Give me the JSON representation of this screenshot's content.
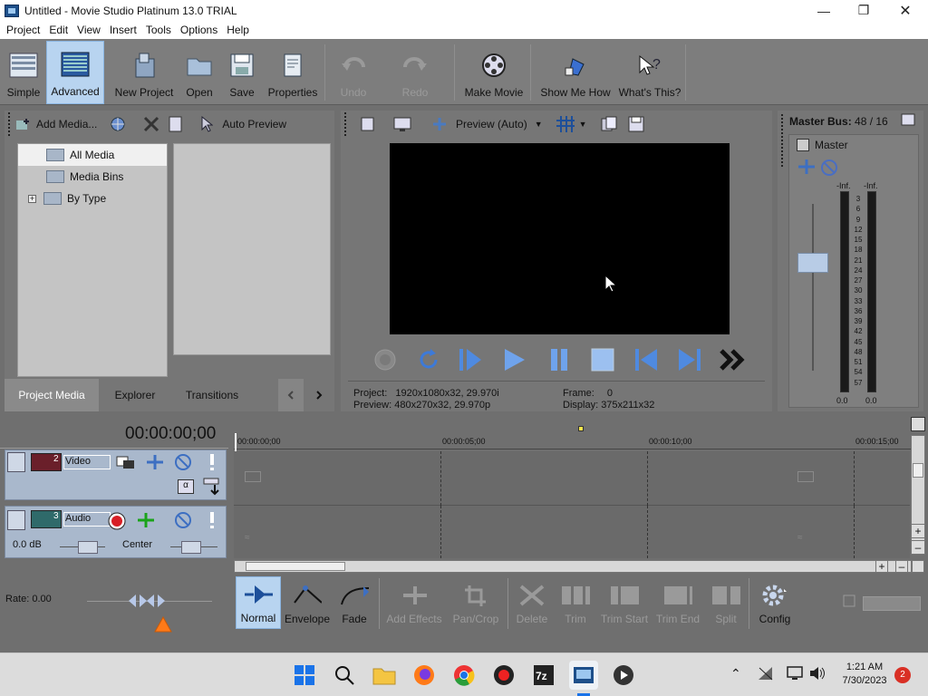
{
  "window": {
    "title": "Untitled - Movie Studio Platinum 13.0 TRIAL"
  },
  "menu": [
    "Project",
    "Edit",
    "View",
    "Insert",
    "Tools",
    "Options",
    "Help"
  ],
  "toolbar": {
    "simple": "Simple",
    "advanced": "Advanced",
    "new_project": "New Project",
    "open": "Open",
    "save": "Save",
    "properties": "Properties",
    "undo": "Undo",
    "redo": "Redo",
    "make_movie": "Make Movie",
    "show_me_how": "Show Me How",
    "whats_this": "What's This?"
  },
  "media_panel": {
    "add_media": "Add Media...",
    "auto_preview": "Auto Preview",
    "tree": [
      "All Media",
      "Media Bins",
      "By Type"
    ],
    "tabs": [
      "Project Media",
      "Explorer",
      "Transitions"
    ]
  },
  "preview": {
    "mode": "Preview (Auto)",
    "project_label": "Project:",
    "project_value": "1920x1080x32, 29.970i",
    "preview_label": "Preview:",
    "preview_value": "480x270x32, 29.970p",
    "frame_label": "Frame:",
    "frame_value": "0",
    "display_label": "Display:",
    "display_value": "375x211x32"
  },
  "master": {
    "title": "Master Bus:",
    "count": "48 / 16",
    "label": "Master",
    "inf": "-Inf.",
    "scale": [
      "3",
      "6",
      "9",
      "12",
      "15",
      "18",
      "21",
      "24",
      "27",
      "30",
      "33",
      "36",
      "39",
      "42",
      "45",
      "48",
      "51",
      "54",
      "57"
    ],
    "bottom": "0.0"
  },
  "timeline": {
    "timecode": "00:00:00;00",
    "ruler": [
      "00:00:00;00",
      "00:00:05;00",
      "00:00:10;00",
      "00:00:15;00"
    ],
    "video_track": {
      "num": "2",
      "name": "Video"
    },
    "audio_track": {
      "num": "3",
      "name": "Audio",
      "vol": "0.0 dB",
      "pan": "Center"
    },
    "rate": "Rate: 0.00"
  },
  "edit_tools": {
    "normal": "Normal",
    "envelope": "Envelope",
    "fade": "Fade",
    "add_effects": "Add Effects",
    "pan_crop": "Pan/Crop",
    "delete": "Delete",
    "trim": "Trim",
    "trim_start": "Trim Start",
    "trim_end": "Trim End",
    "split": "Split",
    "config": "Config"
  },
  "taskbar": {
    "time": "1:21 AM",
    "date": "7/30/2023",
    "badge": "2"
  }
}
